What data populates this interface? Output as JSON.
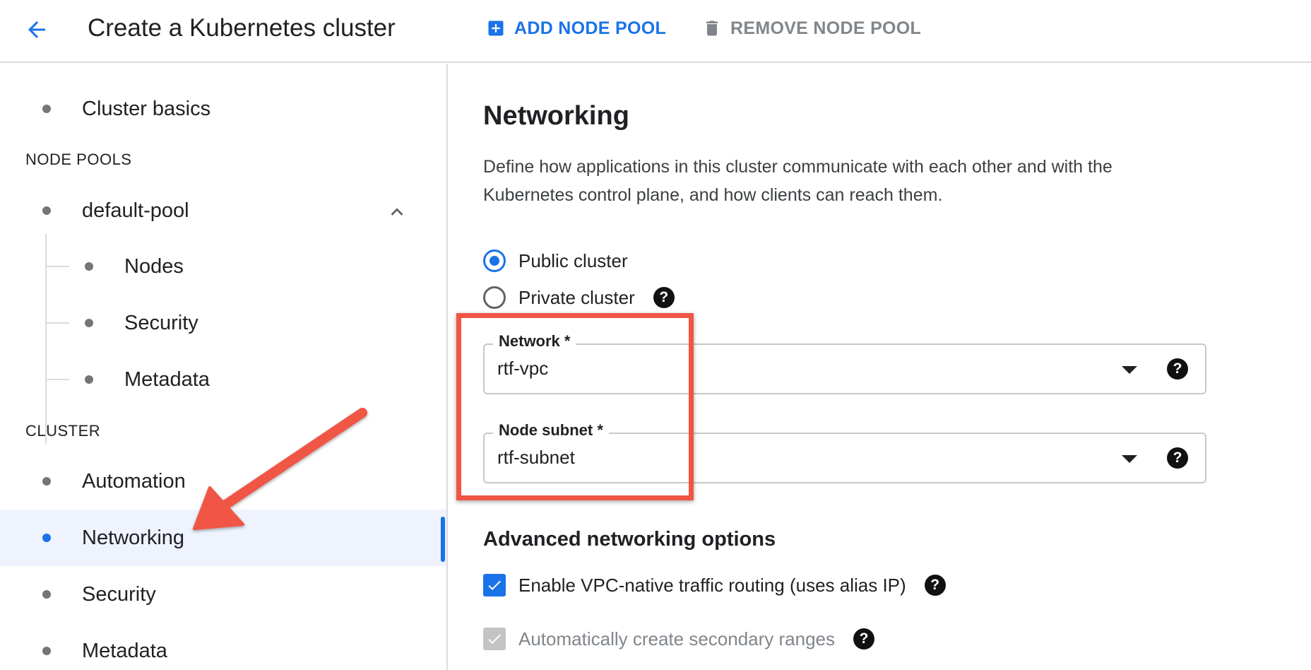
{
  "header": {
    "title": "Create a Kubernetes cluster",
    "add_node_pool": "ADD NODE POOL",
    "remove_node_pool": "REMOVE NODE POOL"
  },
  "sidebar": {
    "cluster_basics": "Cluster basics",
    "node_pools_header": "NODE POOLS",
    "default_pool": "default-pool",
    "pool_items": [
      "Nodes",
      "Security",
      "Metadata"
    ],
    "cluster_header": "CLUSTER",
    "cluster_items": [
      "Automation",
      "Networking",
      "Security",
      "Metadata"
    ],
    "active_item": "Networking"
  },
  "main": {
    "title": "Networking",
    "description": "Define how applications in this cluster communicate with each other and with the Kubernetes control plane, and how clients can reach them.",
    "access": {
      "public_label": "Public cluster",
      "private_label": "Private cluster",
      "selected": "Public cluster"
    },
    "network": {
      "label": "Network *",
      "value": "rtf-vpc"
    },
    "node_subnet": {
      "label": "Node subnet *",
      "value": "rtf-subnet"
    },
    "advanced": {
      "title": "Advanced networking options",
      "vpc_native_label": "Enable VPC-native traffic routing (uses alias IP)",
      "vpc_native_checked": true,
      "secondary_ranges_label": "Automatically create secondary ranges",
      "secondary_ranges_checked": true,
      "secondary_ranges_disabled": true
    }
  },
  "icons": {
    "back": "arrow-back-icon",
    "add": "add-box-icon",
    "remove": "trash-icon",
    "collapse": "chevron-up-icon",
    "help": "help-icon",
    "help_glyph": "?"
  },
  "colors": {
    "accent": "#1a73e8",
    "annotation": "#f05545",
    "active_bg": "#eef3fd"
  }
}
